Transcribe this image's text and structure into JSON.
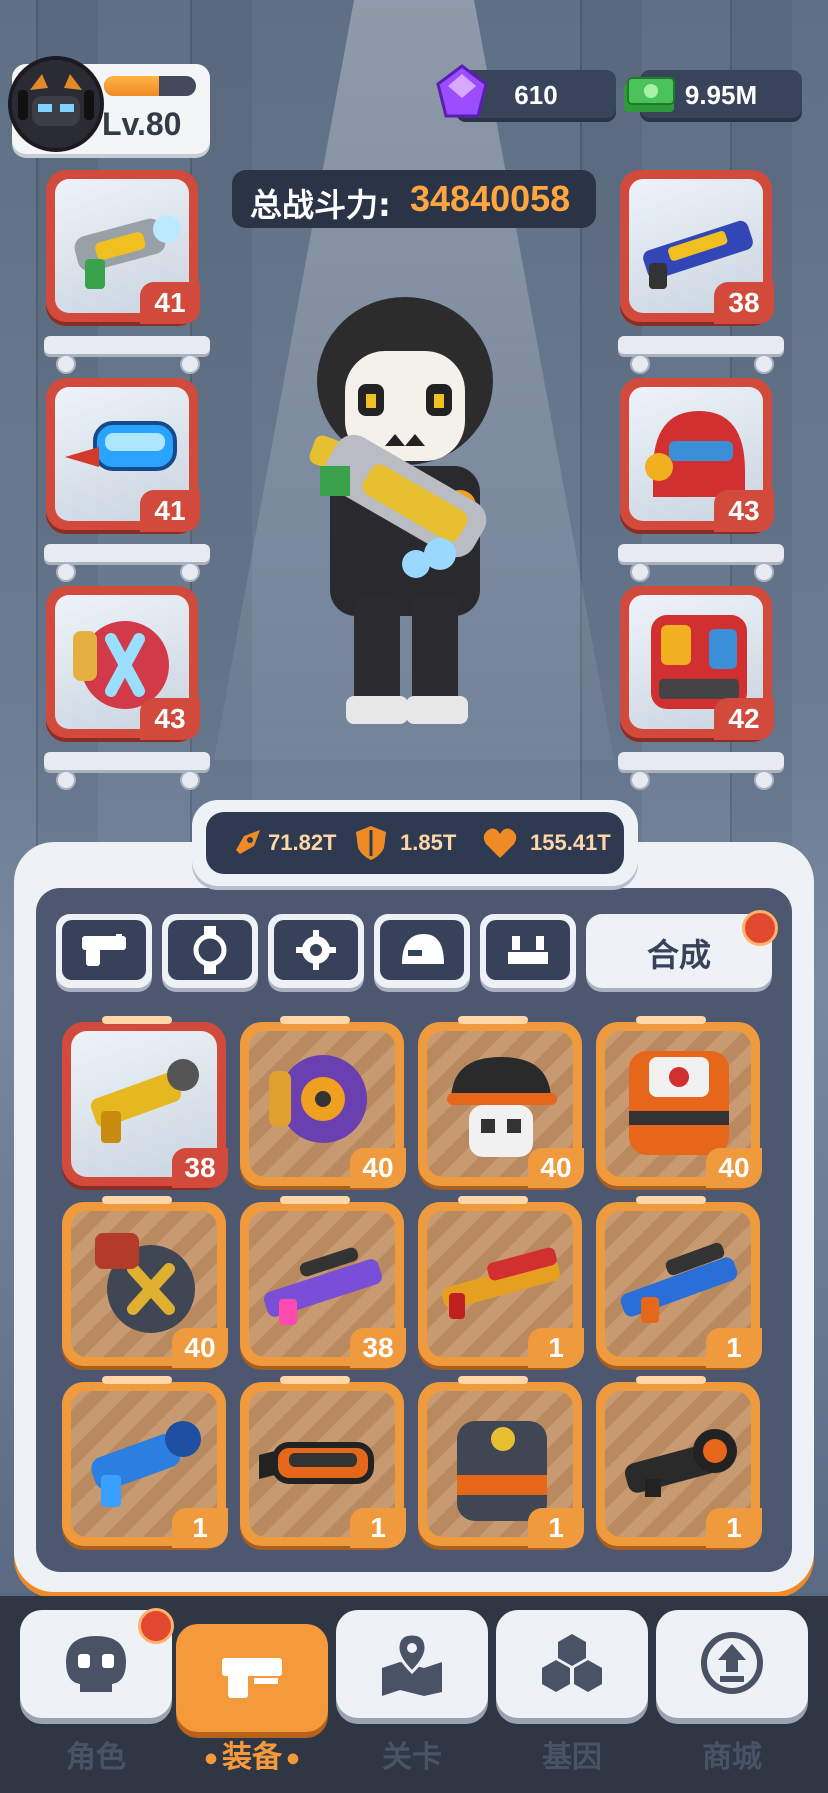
{
  "player": {
    "level": "Lv.80",
    "xp_progress": 0.6
  },
  "currencies": {
    "gems": "610",
    "cash": "9.95M"
  },
  "power": {
    "label": "总战斗力:",
    "value": "34840058"
  },
  "equipped_left": [
    {
      "item": "gatling-blaster",
      "level": "41"
    },
    {
      "item": "cyber-goggles",
      "level": "41"
    },
    {
      "item": "shield-gauntlet",
      "level": "43"
    }
  ],
  "equipped_right": [
    {
      "item": "plasma-rifle",
      "level": "38"
    },
    {
      "item": "red-helmet",
      "level": "43"
    },
    {
      "item": "red-armor",
      "level": "42"
    }
  ],
  "stats": {
    "attack": "71.82T",
    "defense": "1.85T",
    "health": "155.41T"
  },
  "tabs": [
    "gun-icon",
    "watch-icon",
    "gear-icon",
    "helmet-icon",
    "armor-icon"
  ],
  "merge_label": "合成",
  "inventory": [
    {
      "item": "golden-pistol",
      "level": "38",
      "rarity": "red"
    },
    {
      "item": "purple-gauntlet",
      "level": "40",
      "rarity": "orange"
    },
    {
      "item": "skull-cap",
      "level": "40",
      "rarity": "orange"
    },
    {
      "item": "backpack-armor",
      "level": "40",
      "rarity": "orange"
    },
    {
      "item": "ammo-gauntlet",
      "level": "40",
      "rarity": "orange"
    },
    {
      "item": "purple-sniper",
      "level": "38",
      "rarity": "orange"
    },
    {
      "item": "red-shotgun",
      "level": "1",
      "rarity": "orange"
    },
    {
      "item": "blue-rifle",
      "level": "1",
      "rarity": "orange"
    },
    {
      "item": "blue-blaster",
      "level": "1",
      "rarity": "orange"
    },
    {
      "item": "orange-goggles",
      "level": "1",
      "rarity": "orange"
    },
    {
      "item": "dark-armor",
      "level": "1",
      "rarity": "orange"
    },
    {
      "item": "scope",
      "level": "1",
      "rarity": "orange"
    }
  ],
  "nav": [
    {
      "label": "角色",
      "icon": "skull-icon"
    },
    {
      "label": "装备",
      "icon": "gun-icon"
    },
    {
      "label": "关卡",
      "icon": "map-pin-icon"
    },
    {
      "label": "基因",
      "icon": "hexagons-icon"
    },
    {
      "label": "商城",
      "icon": "shop-icon"
    }
  ],
  "colors": {
    "accent": "#f59a3a",
    "rarity_red": "#d24a3c",
    "rarity_orange": "#f09a3e",
    "power_value": "#ffa640"
  }
}
